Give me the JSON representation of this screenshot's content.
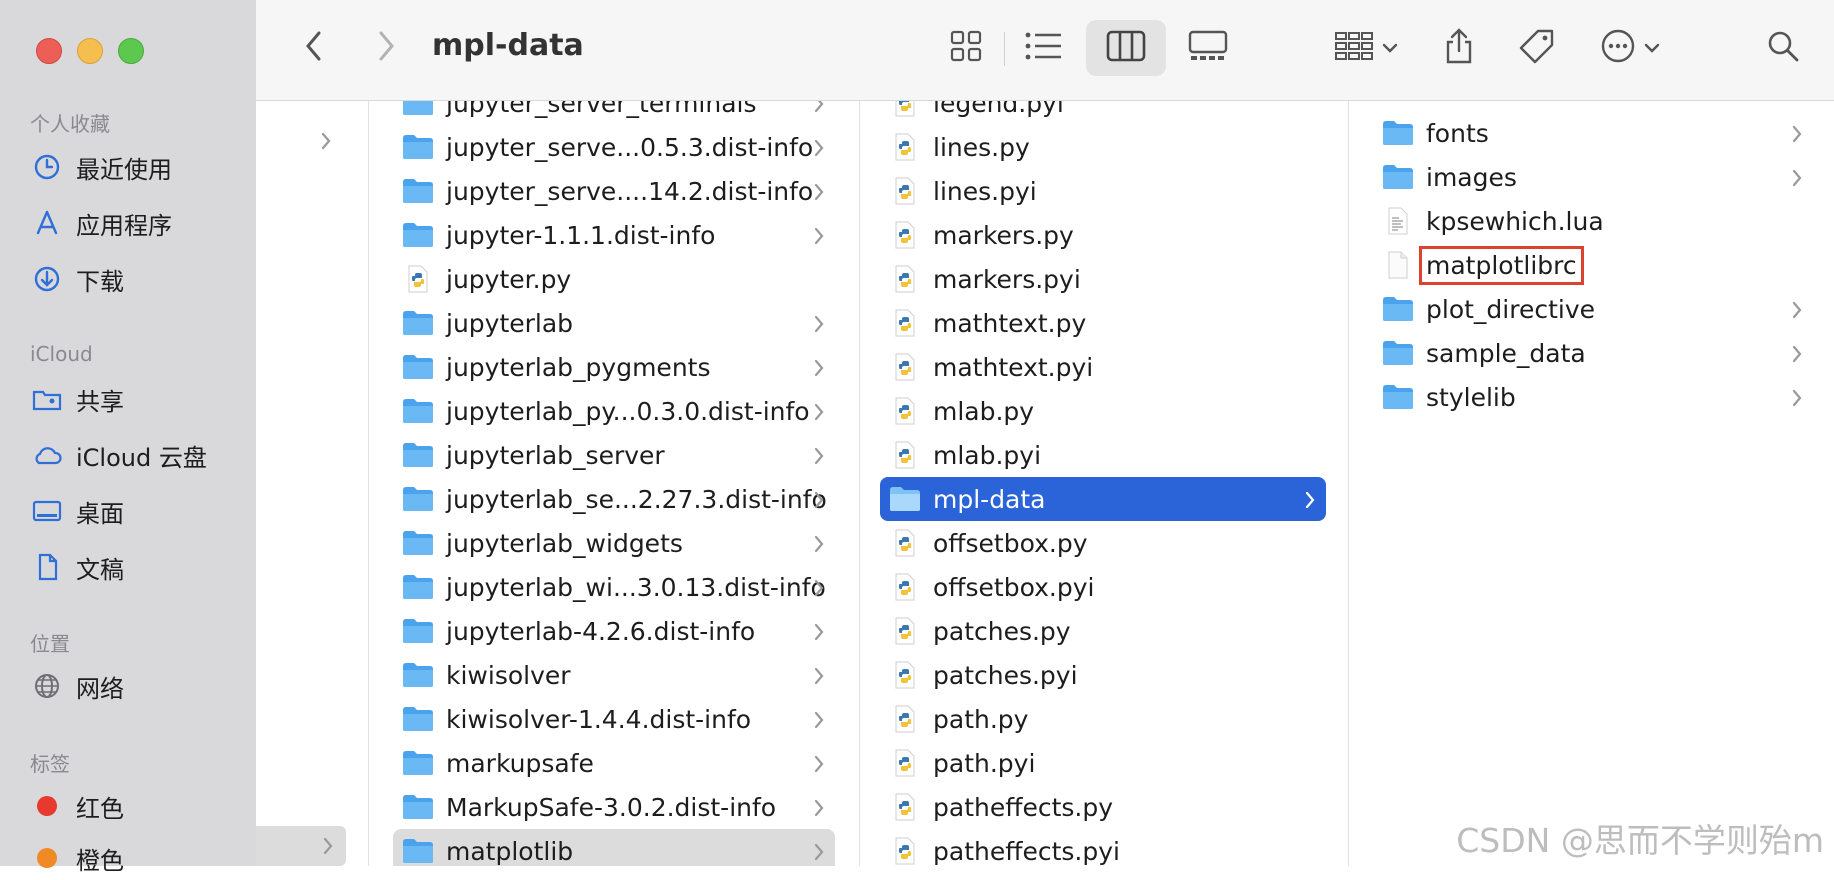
{
  "window": {
    "title": "mpl-data"
  },
  "sidebar": {
    "sections": [
      {
        "header": "个人收藏",
        "items": [
          {
            "label": "最近使用",
            "icon": "clock-icon"
          },
          {
            "label": "应用程序",
            "icon": "apps-icon"
          },
          {
            "label": "下载",
            "icon": "download-icon"
          }
        ]
      },
      {
        "header": "iCloud",
        "items": [
          {
            "label": "共享",
            "icon": "shared-folder-icon"
          },
          {
            "label": "iCloud 云盘",
            "icon": "cloud-icon"
          },
          {
            "label": "桌面",
            "icon": "desktop-icon"
          },
          {
            "label": "文稿",
            "icon": "document-icon"
          }
        ]
      },
      {
        "header": "位置",
        "items": [
          {
            "label": "网络",
            "icon": "network-icon"
          }
        ]
      },
      {
        "header": "标签",
        "items": [
          {
            "label": "红色",
            "icon": "tag-dot-icon",
            "color": "#e8392f"
          },
          {
            "label": "橙色",
            "icon": "tag-dot-icon",
            "color": "#f08a24"
          }
        ]
      }
    ]
  },
  "toolbar": {
    "back": "back-icon",
    "forward": "forward-icon",
    "views": [
      "icon-view",
      "list-view",
      "column-view",
      "gallery-view"
    ],
    "active_view": "column-view"
  },
  "columns": [
    {
      "items": [
        {
          "name": "jupyter_server_terminals",
          "type": "folder",
          "chevron": true
        },
        {
          "name": "jupyter_serve...0.5.3.dist-info",
          "type": "folder",
          "chevron": true
        },
        {
          "name": "jupyter_serve....14.2.dist-info",
          "type": "folder",
          "chevron": true
        },
        {
          "name": "jupyter-1.1.1.dist-info",
          "type": "folder",
          "chevron": true
        },
        {
          "name": "jupyter.py",
          "type": "python",
          "chevron": false
        },
        {
          "name": "jupyterlab",
          "type": "folder",
          "chevron": true
        },
        {
          "name": "jupyterlab_pygments",
          "type": "folder",
          "chevron": true
        },
        {
          "name": "jupyterlab_py...0.3.0.dist-info",
          "type": "folder",
          "chevron": true
        },
        {
          "name": "jupyterlab_server",
          "type": "folder",
          "chevron": true
        },
        {
          "name": "jupyterlab_se...2.27.3.dist-info",
          "type": "folder",
          "chevron": true
        },
        {
          "name": "jupyterlab_widgets",
          "type": "folder",
          "chevron": true
        },
        {
          "name": "jupyterlab_wi...3.0.13.dist-info",
          "type": "folder",
          "chevron": true
        },
        {
          "name": "jupyterlab-4.2.6.dist-info",
          "type": "folder",
          "chevron": true
        },
        {
          "name": "kiwisolver",
          "type": "folder",
          "chevron": true
        },
        {
          "name": "kiwisolver-1.4.4.dist-info",
          "type": "folder",
          "chevron": true
        },
        {
          "name": "markupsafe",
          "type": "folder",
          "chevron": true
        },
        {
          "name": "MarkupSafe-3.0.2.dist-info",
          "type": "folder",
          "chevron": true
        },
        {
          "name": "matplotlib",
          "type": "folder",
          "chevron": true,
          "state": "path"
        }
      ]
    },
    {
      "items": [
        {
          "name": "legend.pyi",
          "type": "python"
        },
        {
          "name": "lines.py",
          "type": "python"
        },
        {
          "name": "lines.pyi",
          "type": "python"
        },
        {
          "name": "markers.py",
          "type": "python"
        },
        {
          "name": "markers.pyi",
          "type": "python"
        },
        {
          "name": "mathtext.py",
          "type": "python"
        },
        {
          "name": "mathtext.pyi",
          "type": "python"
        },
        {
          "name": "mlab.py",
          "type": "python"
        },
        {
          "name": "mlab.pyi",
          "type": "python"
        },
        {
          "name": "mpl-data",
          "type": "folder",
          "chevron": true,
          "state": "selected"
        },
        {
          "name": "offsetbox.py",
          "type": "python"
        },
        {
          "name": "offsetbox.pyi",
          "type": "python"
        },
        {
          "name": "patches.py",
          "type": "python"
        },
        {
          "name": "patches.pyi",
          "type": "python"
        },
        {
          "name": "path.py",
          "type": "python"
        },
        {
          "name": "path.pyi",
          "type": "python"
        },
        {
          "name": "patheffects.py",
          "type": "python"
        },
        {
          "name": "patheffects.pyi",
          "type": "python"
        }
      ]
    },
    {
      "items": [
        {
          "name": "fonts",
          "type": "folder",
          "chevron": true
        },
        {
          "name": "images",
          "type": "folder",
          "chevron": true
        },
        {
          "name": "kpsewhich.lua",
          "type": "textfile"
        },
        {
          "name": "matplotlibrc",
          "type": "blankfile",
          "highlighted": true
        },
        {
          "name": "plot_directive",
          "type": "folder",
          "chevron": true
        },
        {
          "name": "sample_data",
          "type": "folder",
          "chevron": true
        },
        {
          "name": "stylelib",
          "type": "folder",
          "chevron": true
        }
      ]
    }
  ],
  "watermark": "CSDN @思而不学则殆m",
  "colors": {
    "selection": "#2b63d9",
    "folder": "#5aaef0",
    "highlight_box": "#d9432f"
  }
}
